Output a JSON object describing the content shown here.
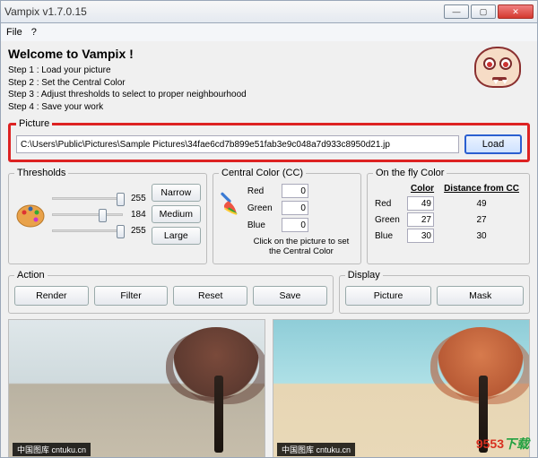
{
  "window": {
    "title": "Vampix v1.7.0.15"
  },
  "menu": {
    "file": "File",
    "help": "?"
  },
  "welcome": {
    "heading": "Welcome to Vampix !",
    "steps": [
      "Step 1 : Load your picture",
      "Step 2 : Set the Central Color",
      "Step 3 : Adjust thresholds to select to proper neighbourhood",
      "Step 4 : Save your work"
    ]
  },
  "picture": {
    "legend": "Picture",
    "path": "C:\\Users\\Public\\Pictures\\Sample Pictures\\34fae6cd7b899e51fab3e9c048a7d933c8950d21.jp",
    "load": "Load"
  },
  "thresholds": {
    "legend": "Thresholds",
    "values": [
      255,
      184,
      255
    ],
    "narrow": "Narrow",
    "medium": "Medium",
    "large": "Large"
  },
  "central": {
    "legend": "Central Color (CC)",
    "red_label": "Red",
    "green_label": "Green",
    "blue_label": "Blue",
    "red": 0,
    "green": 0,
    "blue": 0,
    "hint": "Click on the picture to set the Central Color"
  },
  "fly": {
    "legend": "On the fly Color",
    "col_color": "Color",
    "col_dist": "Distance from CC",
    "red_label": "Red",
    "green_label": "Green",
    "blue_label": "Blue",
    "red": 49,
    "green": 27,
    "blue": 30,
    "red_dist": 49,
    "green_dist": 27,
    "blue_dist": 30
  },
  "action": {
    "legend": "Action",
    "render": "Render",
    "filter": "Filter",
    "reset": "Reset",
    "save": "Save"
  },
  "display": {
    "legend": "Display",
    "picture": "Picture",
    "mask": "Mask"
  },
  "watermark": "中国图库 cntuku.cn",
  "brand": {
    "name": "9553",
    "suffix": "下载"
  }
}
